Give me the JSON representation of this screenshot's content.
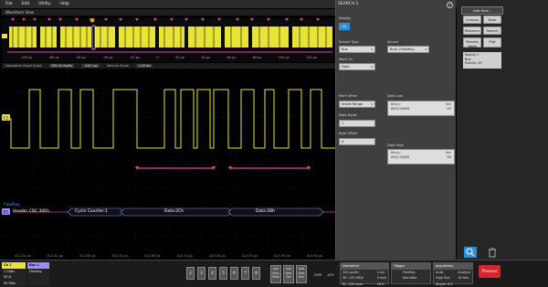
{
  "menu": {
    "items": [
      "File",
      "Edit",
      "Utility",
      "Help"
    ]
  },
  "waveform_view": {
    "title": "Waveform View"
  },
  "overview_axis": [
    "-105 μs",
    "-80 μs",
    "-60 μs",
    "-40 μs",
    "-20 μs",
    "0",
    "20 μs",
    "40 μs",
    "60 μs",
    "80 μs",
    "100 μs",
    "120 μs"
  ],
  "status_bar": {
    "zoom_label": "Horizontal Zoom Scale",
    "zoom_value": "200.00 ns/div",
    "position_value": "-410.1μs",
    "vert_label": "Vertical Zoom",
    "vert_value": "1.00 div"
  },
  "decode": {
    "bus_name": "FlexRay",
    "bus_tag": "B1",
    "ch_tag": "C1",
    "frames": [
      "Header CRC:30Eh",
      "Cycle Counter:1",
      "Data:2Ch",
      "Data:28h",
      "Data:99h",
      "Data:F7h"
    ]
  },
  "time_axis": [
    "412.32 μs",
    "412.32 μs",
    "412.50 μs",
    "412.70 μs",
    "412.90 μs",
    "413.10 μs",
    "413.30 μs",
    "413.50 μs",
    "413.70 μs",
    "413.90 μs"
  ],
  "search_panel": {
    "title": "SEARCH 1",
    "display_label": "Display",
    "display_state": "On",
    "search_type_label": "Search Type",
    "search_type_value": "Bus",
    "source_label": "Source",
    "source_value": "Bus1 (FlexRay)",
    "mark_on_label": "Mark On",
    "mark_on_value": "Data",
    "mark_when_label": "Mark When",
    "mark_when_value": "Inside Range",
    "data_bytes_label": "Data Bytes",
    "data_bytes_value": "1",
    "byte_offset_label": "Byte Offset",
    "byte_offset_value": "0",
    "data_low": {
      "title": "Data Low",
      "binary_label": "Binary",
      "hex_label": "Hex",
      "binary_value": "0010 XXXX",
      "hex_value": "2X"
    },
    "data_high": {
      "title": "Data High",
      "binary_label": "Binary",
      "hex_label": "Hex",
      "binary_value": "0011 XXXX",
      "hex_value": "3X"
    }
  },
  "right_panel": {
    "add_new": "Add New...",
    "buttons": [
      "Cursors",
      "Note",
      "Measure",
      "Search",
      "Results Table",
      "Plot"
    ],
    "search_badge": {
      "title": "Search 1",
      "line1": "Bus",
      "line2": "Events: 49"
    }
  },
  "bottom": {
    "ch1": {
      "title": "Ch 1",
      "l1": "1 V/div",
      "l2": "50 Ω",
      "l3": "50 MHz"
    },
    "bus1": {
      "title": "Bus 1",
      "l1": "FlexRay"
    },
    "channel_numbers": [
      "2",
      "3",
      "4",
      "5",
      "6",
      "7",
      "8"
    ],
    "add_math": [
      "Add",
      "New",
      "Math"
    ],
    "add_ref": [
      "Add",
      "New",
      "Ref"
    ],
    "add_bus": [
      "Add",
      "New",
      "Bus"
    ],
    "dvm": "DVM",
    "afg": "AFG",
    "horizontal": {
      "title": "Horizontal",
      "l1": "200 μs/div",
      "l2": "SR: 125 MS/s",
      "l3": "RL: 250 kpts",
      "r1": "2 ms",
      "r2": "0 mpt",
      "r3": "20%"
    },
    "trigger": {
      "title": "Trigger",
      "l1": "FlexRay",
      "l2": "Identifier"
    },
    "acquisition": {
      "title": "Acquisition",
      "l1": "Auto,",
      "l2": "High Res",
      "l3": "Single: 0/1",
      "r1": "Analyze",
      "r2": "16 bits"
    },
    "stop": "Previous"
  },
  "colors": {
    "ch1": "#e8e337",
    "bus": "#d946a8",
    "accent": "#2d8fd6",
    "stop": "#d4262b"
  }
}
